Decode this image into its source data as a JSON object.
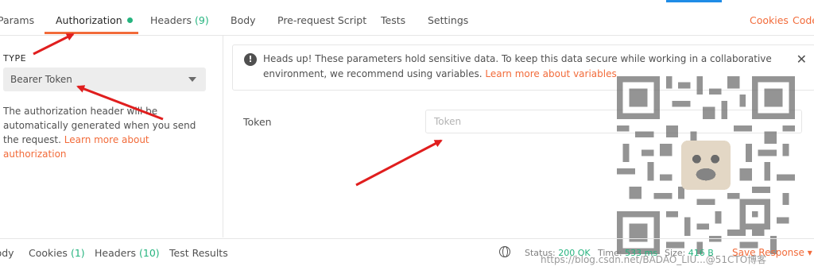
{
  "tabs": {
    "params": "Params",
    "authorization": "Authorization",
    "headers": "Headers",
    "headers_count": "(9)",
    "body": "Body",
    "prerequest": "Pre-request Script",
    "tests": "Tests",
    "settings": "Settings",
    "cookies_link": "Cookies",
    "code_link": "Code"
  },
  "auth": {
    "type_label": "TYPE",
    "type_value": "Bearer Token",
    "help_text": "The authorization header will be automatically generated when you send the request. ",
    "help_link": "Learn more about authorization"
  },
  "alert": {
    "text": "Heads up! These parameters hold sensitive data. To keep this data secure while working in a collaborative environment, we recommend using variables. ",
    "link": "Learn more about variables",
    "icon": "!",
    "close": "✕"
  },
  "token": {
    "label": "Token",
    "placeholder": "Token"
  },
  "response_tabs": {
    "body": "Body",
    "cookies": "Cookies",
    "cookies_count": "(1)",
    "headers": "Headers",
    "headers_count": "(10)",
    "test_results": "Test Results"
  },
  "status": {
    "status_label": "Status:",
    "status_value": "200 OK",
    "time_label": "Time:",
    "time_value": "533 ms",
    "size_label": "Size:",
    "size_value": "416 B",
    "save_response": "Save Response ▾"
  },
  "watermark": "https://blog.csdn.net/BADAO_LIU...@51CTO博客",
  "colors": {
    "accent": "#f26b3a",
    "success": "#26b47f",
    "text": "#505050",
    "border": "#e6e6e6",
    "arrow": "#e01e1e"
  },
  "icons": {
    "alert": "info-icon",
    "close": "close-icon",
    "globe": "globe-icon",
    "caret": "caret-down-icon"
  }
}
